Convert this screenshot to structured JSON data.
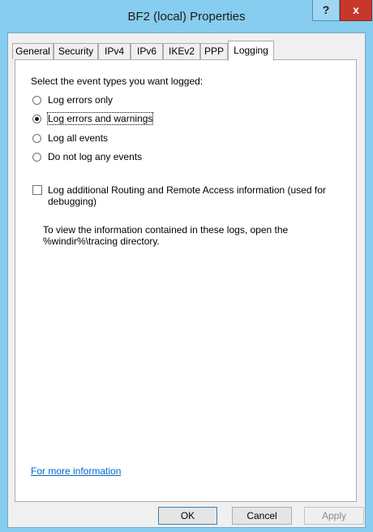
{
  "window": {
    "title": "BF2 (local) Properties",
    "help_label": "?",
    "close_label": "x"
  },
  "tabs": [
    {
      "label": "General"
    },
    {
      "label": "Security"
    },
    {
      "label": "IPv4"
    },
    {
      "label": "IPv6"
    },
    {
      "label": "IKEv2"
    },
    {
      "label": "PPP"
    },
    {
      "label": "Logging",
      "active": true
    }
  ],
  "logging": {
    "prompt": "Select the event types you want logged:",
    "options": [
      {
        "label": "Log errors only",
        "checked": false
      },
      {
        "label": "Log errors and warnings",
        "checked": true
      },
      {
        "label": "Log all events",
        "checked": false
      },
      {
        "label": "Do not log any events",
        "checked": false
      }
    ],
    "additional_checkbox": {
      "line1": "Log additional Routing and Remote Access information (used for",
      "line2": "debugging)",
      "checked": false
    },
    "info_line1": "To view the information contained in these logs, open the",
    "info_line2": "%windir%\\tracing directory.",
    "more_info_link": "For more information"
  },
  "buttons": {
    "ok": "OK",
    "cancel": "Cancel",
    "apply": "Apply"
  }
}
